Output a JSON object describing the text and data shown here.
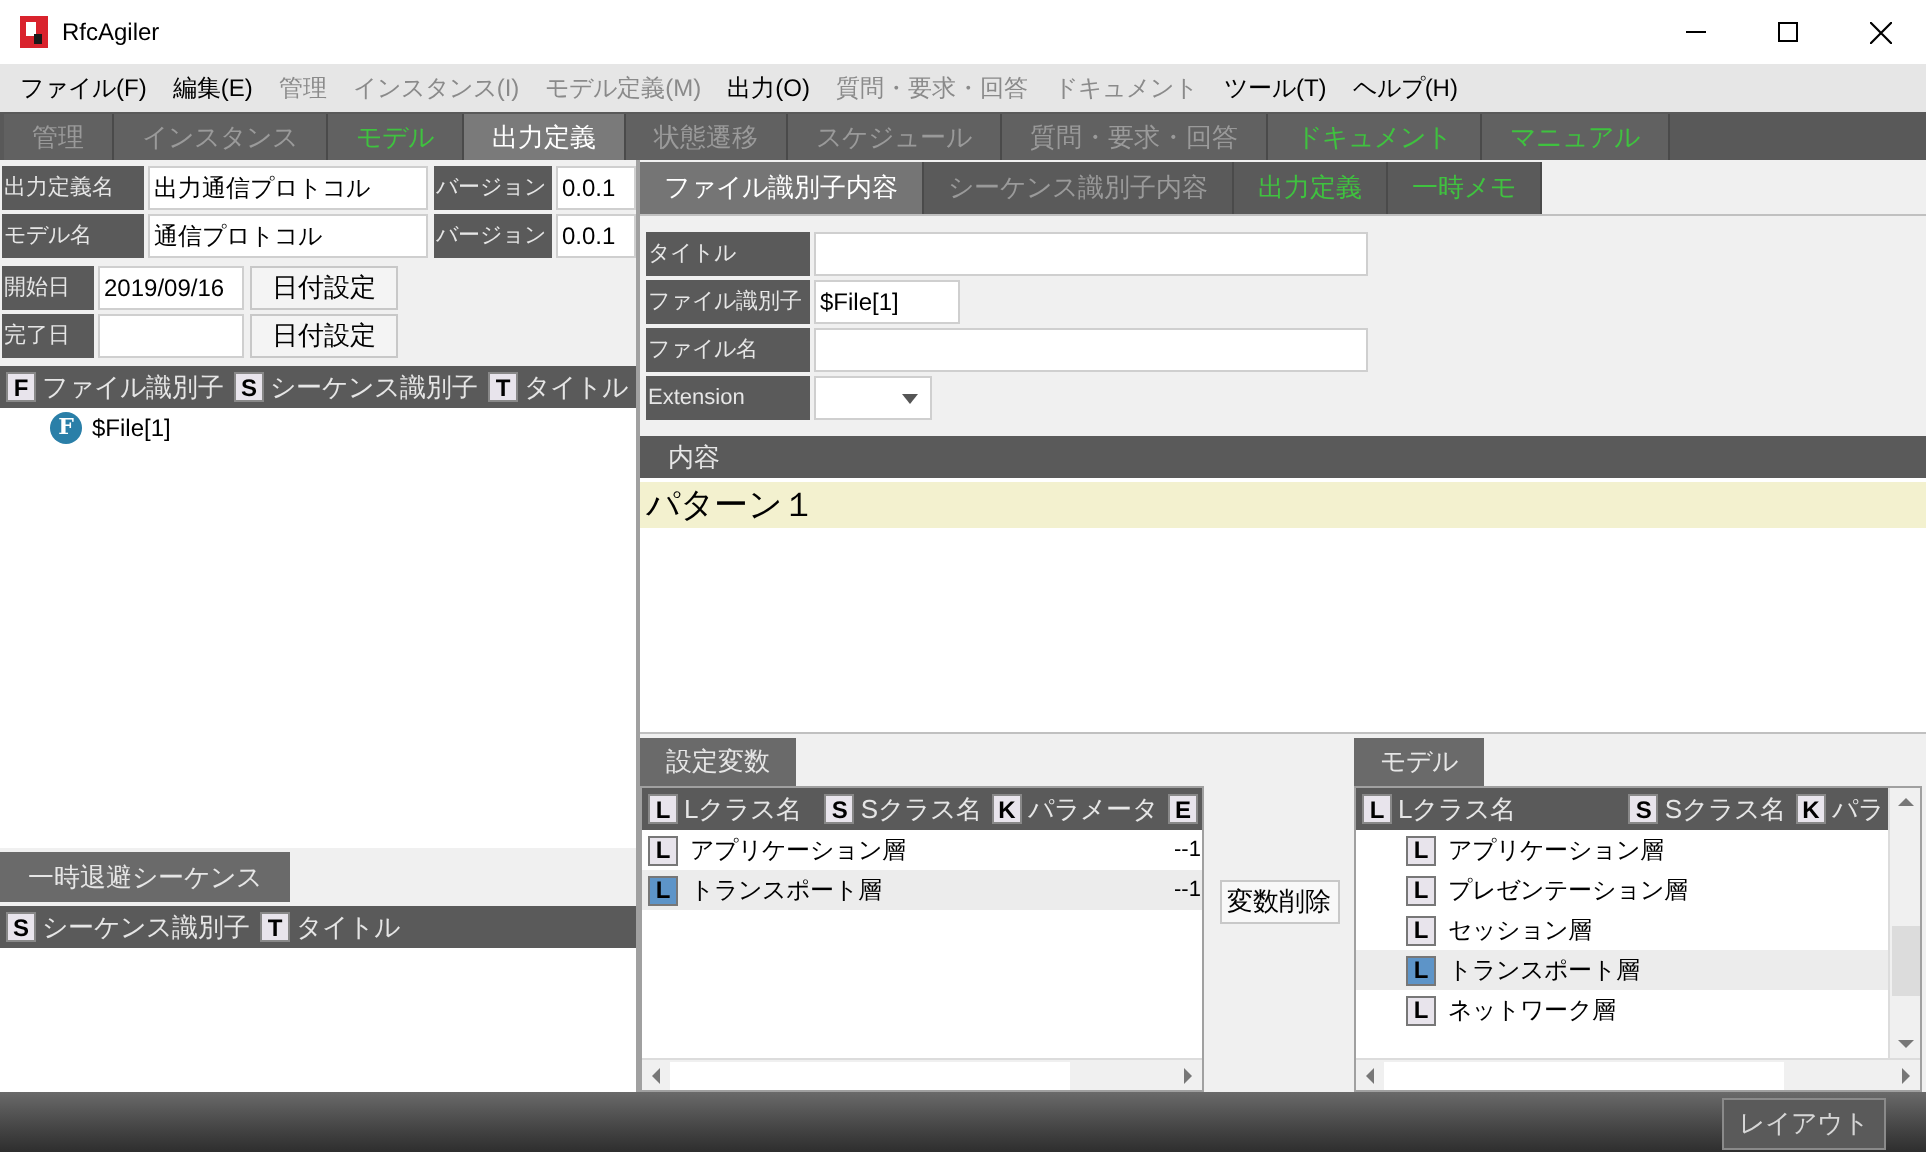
{
  "window": {
    "title": "RfcAgiler"
  },
  "menu": [
    {
      "label": "ファイル(F)",
      "disabled": false
    },
    {
      "label": "編集(E)",
      "disabled": false
    },
    {
      "label": "管理",
      "disabled": true
    },
    {
      "label": "インスタンス(I)",
      "disabled": true
    },
    {
      "label": "モデル定義(M)",
      "disabled": true
    },
    {
      "label": "出力(O)",
      "disabled": false
    },
    {
      "label": "質問・要求・回答",
      "disabled": true
    },
    {
      "label": "ドキュメント",
      "disabled": true
    },
    {
      "label": "ツール(T)",
      "disabled": false
    },
    {
      "label": "ヘルプ(H)",
      "disabled": false
    }
  ],
  "main_tabs": [
    {
      "label": "管理",
      "kind": "disabled",
      "selected": false
    },
    {
      "label": "インスタンス",
      "kind": "disabled",
      "selected": false
    },
    {
      "label": "モデル",
      "kind": "green",
      "selected": false
    },
    {
      "label": "出力定義",
      "kind": "normal",
      "selected": true
    },
    {
      "label": "状態遷移",
      "kind": "disabled",
      "selected": false
    },
    {
      "label": "スケジュール",
      "kind": "disabled",
      "selected": false
    },
    {
      "label": "質問・要求・回答",
      "kind": "disabled",
      "selected": false
    },
    {
      "label": "ドキュメント",
      "kind": "green",
      "selected": false
    },
    {
      "label": "マニュアル",
      "kind": "green",
      "selected": false
    }
  ],
  "definition": [
    {
      "label": "出力定義名",
      "value": "出力通信プロトコル",
      "version_label": "バージョン",
      "version": "0.0.1"
    },
    {
      "label": "モデル名",
      "value": "通信プロトコル",
      "version_label": "バージョン",
      "version": "0.0.1"
    }
  ],
  "dates": [
    {
      "label": "開始日",
      "value": "2019/09/16",
      "button": "日付設定"
    },
    {
      "label": "完了日",
      "button": "日付設定"
    }
  ],
  "identifiers": {
    "columns": [
      {
        "badge": "F",
        "label": "ファイル識別子"
      },
      {
        "badge": "S",
        "label": "シーケンス識別子"
      },
      {
        "badge": "T",
        "label": "タイトル"
      }
    ],
    "items": [
      {
        "badge": "F",
        "label": "$File[1]"
      }
    ]
  },
  "temp_sequences": {
    "tab": "一時退避シーケンス",
    "columns": [
      {
        "badge": "S",
        "label": "シーケンス識別子"
      },
      {
        "badge": "T",
        "label": "タイトル"
      }
    ]
  },
  "detail_tabs": [
    {
      "label": "ファイル識別子内容",
      "kind": "normal",
      "selected": true
    },
    {
      "label": "シーケンス識別子内容",
      "kind": "disabled",
      "selected": false
    },
    {
      "label": "出力定義",
      "kind": "green",
      "selected": false
    },
    {
      "label": "一時メモ",
      "kind": "green",
      "selected": false
    }
  ],
  "detail_form": [
    {
      "kind": "text",
      "label": "タイトル"
    },
    {
      "kind": "short",
      "label": "ファイル識別子",
      "value": "$File[1]"
    },
    {
      "kind": "text",
      "label": "ファイル名"
    },
    {
      "kind": "select",
      "label": "Extension"
    }
  ],
  "content": {
    "header": "内容",
    "lines": [
      {
        "text": "パターン１",
        "highlighted": true
      }
    ]
  },
  "variables": {
    "tab": "設定変数",
    "columns": [
      {
        "badge": "L",
        "label": "Lクラス名"
      },
      {
        "badge": "S",
        "label": "Sクラス名"
      },
      {
        "badge": "K",
        "label": "パラメータ"
      },
      {
        "badge": "E"
      }
    ],
    "rows": [
      {
        "badge": "L",
        "name": "アプリケーション層",
        "column_4": "--1",
        "selected": false
      },
      {
        "badge": "L",
        "name": "トランスポート層",
        "column_4": "--1",
        "selected": true
      }
    ]
  },
  "delete_button": "変数削除",
  "model": {
    "tab": "モデル",
    "columns": [
      {
        "badge": "L",
        "label": "Lクラス名"
      },
      {
        "badge": "S",
        "label": "Sクラス名"
      },
      {
        "badge": "K",
        "label": "パラ"
      }
    ],
    "items": [
      {
        "badge": "L",
        "name": "アプリケーション層",
        "selected": false
      },
      {
        "badge": "L",
        "name": "プレゼンテーション層",
        "selected": false
      },
      {
        "badge": "L",
        "name": "セッション層",
        "selected": false
      },
      {
        "badge": "L",
        "name": "トランスポート層",
        "selected": true
      },
      {
        "badge": "L",
        "name": "ネットワーク層",
        "selected": false
      }
    ]
  },
  "layout_button": "レイアウト"
}
